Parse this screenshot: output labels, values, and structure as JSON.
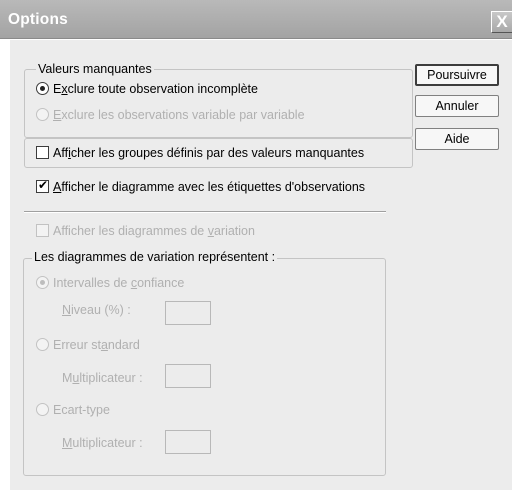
{
  "window": {
    "title": "Options",
    "close_glyph": "X"
  },
  "buttons": {
    "continue": "Poursuivre",
    "cancel": "Annuler",
    "help": "Aide"
  },
  "missing_values": {
    "group_label": "Valeurs manquantes",
    "exclude_listwise": {
      "pre": "E",
      "key": "x",
      "post": "clure toute observation incomplète",
      "checked": true,
      "enabled": true
    },
    "exclude_pairwise": {
      "pre": "",
      "key": "E",
      "post": "xclure les observations variable par variable",
      "checked": false,
      "enabled": false
    },
    "show_missing_groups": {
      "pre": "Aff",
      "key": "i",
      "post": "cher les groupes définis par des valeurs manquantes",
      "checked": false,
      "enabled": true
    }
  },
  "show_chart_case_labels": {
    "pre": "",
    "key": "A",
    "post": "fficher le diagramme avec les étiquettes d'observations",
    "checked": true,
    "enabled": true
  },
  "show_error_bars": {
    "pre": "Afficher les diagrammes de ",
    "key": "v",
    "post": "ariation",
    "checked": false,
    "enabled": false
  },
  "error_bars": {
    "group_label": "Les diagrammes de variation représentent :",
    "confidence_intervals": {
      "pre": "Intervalles de ",
      "key": "c",
      "post": "onfiance",
      "checked": true,
      "enabled": false
    },
    "level": {
      "pre": "",
      "key": "N",
      "post": "iveau (%) :",
      "value": ""
    },
    "standard_error": {
      "pre": "Erreur st",
      "key": "a",
      "post": "ndard",
      "checked": false,
      "enabled": false
    },
    "se_multiplier": {
      "pre": "M",
      "key": "u",
      "post": "ltiplicateur :",
      "value": ""
    },
    "standard_deviation": {
      "pre": "Ecart-type",
      "key": "",
      "post": "",
      "checked": false,
      "enabled": false
    },
    "sd_multiplier": {
      "pre": "",
      "key": "M",
      "post": "ultiplicateur :",
      "value": ""
    }
  }
}
